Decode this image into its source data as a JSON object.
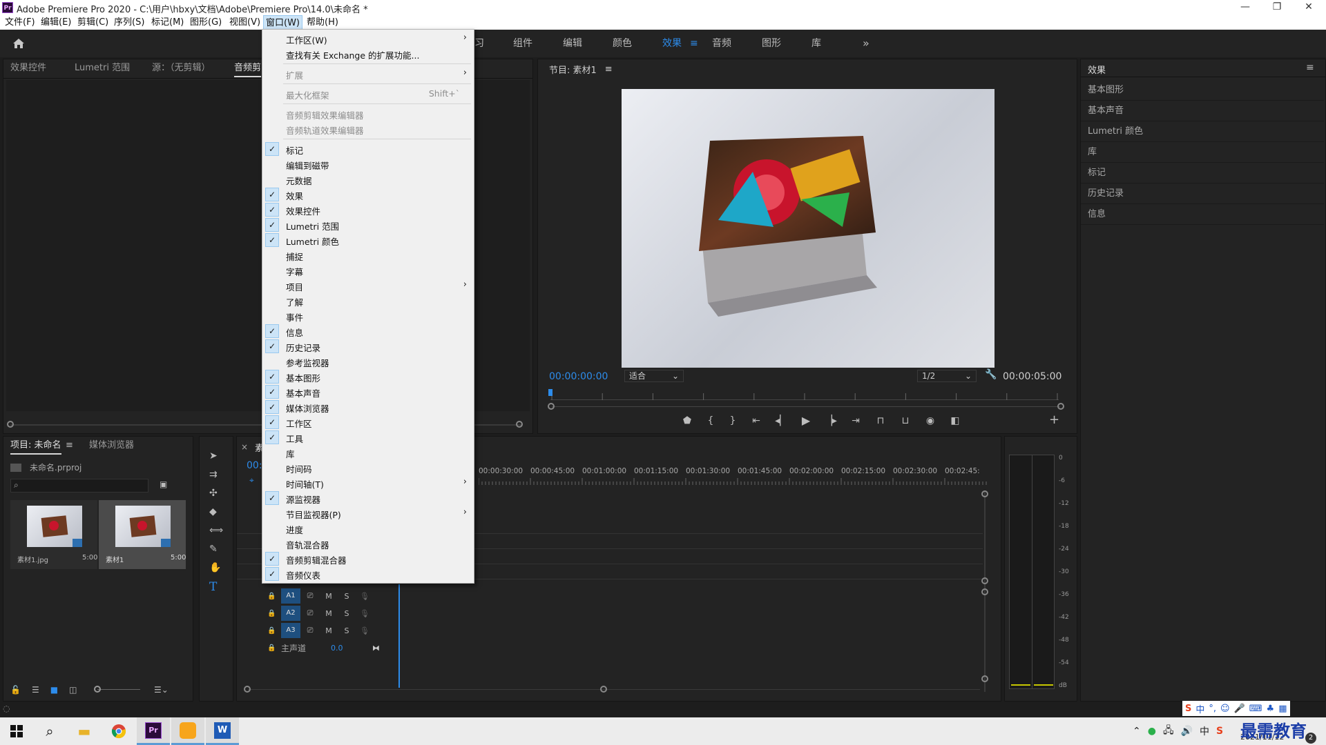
{
  "window": {
    "app_title": "Adobe Premiere Pro 2020 - C:\\用户\\hbxy\\文档\\Adobe\\Premiere Pro\\14.0\\未命名 *",
    "minimize": "—",
    "maximize": "❐",
    "close": "✕"
  },
  "menubar": {
    "items": [
      "文件(F)",
      "编辑(E)",
      "剪辑(C)",
      "序列(S)",
      "标记(M)",
      "图形(G)",
      "视图(V)",
      "窗口(W)",
      "帮助(H)"
    ],
    "active": "窗口(W)"
  },
  "workspaces": {
    "tabs": [
      "习",
      "组件",
      "编辑",
      "颜色",
      "效果",
      "音频",
      "图形",
      "库"
    ],
    "active": "效果",
    "more": "»"
  },
  "window_menu": {
    "items": [
      {
        "label": "工作区(W)",
        "checked": false,
        "submenu": true,
        "disabled": false
      },
      {
        "label": "查找有关 Exchange 的扩展功能...",
        "checked": false,
        "submenu": false,
        "disabled": false
      },
      {
        "label": "扩展",
        "checked": false,
        "submenu": true,
        "disabled": true
      },
      {
        "label": "最大化框架",
        "checked": false,
        "submenu": false,
        "disabled": true,
        "shortcut": "Shift+`"
      },
      {
        "label": "音频剪辑效果编辑器",
        "checked": false,
        "submenu": false,
        "disabled": true
      },
      {
        "label": "音频轨道效果编辑器",
        "checked": false,
        "submenu": false,
        "disabled": true
      },
      {
        "label": "标记",
        "checked": true,
        "submenu": false,
        "disabled": false
      },
      {
        "label": "编辑到磁带",
        "checked": false,
        "submenu": false,
        "disabled": false
      },
      {
        "label": "元数据",
        "checked": false,
        "submenu": false,
        "disabled": false
      },
      {
        "label": "效果",
        "checked": true,
        "submenu": false,
        "disabled": false
      },
      {
        "label": "效果控件",
        "checked": true,
        "submenu": false,
        "disabled": false
      },
      {
        "label": "Lumetri 范围",
        "checked": true,
        "submenu": false,
        "disabled": false
      },
      {
        "label": "Lumetri 颜色",
        "checked": true,
        "submenu": false,
        "disabled": false
      },
      {
        "label": "捕捉",
        "checked": false,
        "submenu": false,
        "disabled": false
      },
      {
        "label": "字幕",
        "checked": false,
        "submenu": false,
        "disabled": false
      },
      {
        "label": "项目",
        "checked": false,
        "submenu": true,
        "disabled": false
      },
      {
        "label": "了解",
        "checked": false,
        "submenu": false,
        "disabled": false
      },
      {
        "label": "事件",
        "checked": false,
        "submenu": false,
        "disabled": false
      },
      {
        "label": "信息",
        "checked": true,
        "submenu": false,
        "disabled": false
      },
      {
        "label": "历史记录",
        "checked": true,
        "submenu": false,
        "disabled": false
      },
      {
        "label": "参考监视器",
        "checked": false,
        "submenu": false,
        "disabled": false
      },
      {
        "label": "基本图形",
        "checked": true,
        "submenu": false,
        "disabled": false
      },
      {
        "label": "基本声音",
        "checked": true,
        "submenu": false,
        "disabled": false
      },
      {
        "label": "媒体浏览器",
        "checked": true,
        "submenu": false,
        "disabled": false
      },
      {
        "label": "工作区",
        "checked": true,
        "submenu": false,
        "disabled": false
      },
      {
        "label": "工具",
        "checked": true,
        "submenu": false,
        "disabled": false
      },
      {
        "label": "库",
        "checked": false,
        "submenu": false,
        "disabled": false
      },
      {
        "label": "时间码",
        "checked": false,
        "submenu": false,
        "disabled": false
      },
      {
        "label": "时间轴(T)",
        "checked": false,
        "submenu": true,
        "disabled": false
      },
      {
        "label": "源监视器",
        "checked": true,
        "submenu": false,
        "disabled": false
      },
      {
        "label": "节目监视器(P)",
        "checked": false,
        "submenu": true,
        "disabled": false
      },
      {
        "label": "进度",
        "checked": false,
        "submenu": false,
        "disabled": false
      },
      {
        "label": "音轨混合器",
        "checked": false,
        "submenu": false,
        "disabled": false
      },
      {
        "label": "音频剪辑混合器",
        "checked": true,
        "submenu": false,
        "disabled": false
      },
      {
        "label": "音频仪表",
        "checked": true,
        "submenu": false,
        "disabled": false
      }
    ],
    "check_glyph": "✓",
    "arrow_glyph": "›"
  },
  "source_panel": {
    "tabs": [
      "效果控件",
      "Lumetri 范围",
      "源：（无剪辑）",
      "音频剪"
    ],
    "active": "音频剪"
  },
  "program_monitor": {
    "title": "节目: 素材1",
    "menu_icon": "≡",
    "timecode_current": "00:00:00:00",
    "fit_label": "适合",
    "resolution": "1/2",
    "timecode_duration": "00:00:05:00"
  },
  "effects_panel": {
    "title": "效果",
    "menu_icon": "≡",
    "items": [
      "基本图形",
      "基本声音",
      "Lumetri 颜色",
      "库",
      "标记",
      "历史记录",
      "信息"
    ]
  },
  "project_panel": {
    "tabs": [
      "项目: 未命名",
      "媒体浏览器"
    ],
    "menu_icon": "≡",
    "project_file": "未命名.prproj",
    "items": [
      {
        "name": "素材1.jpg",
        "duration": "5:00"
      },
      {
        "name": "素材1",
        "duration": "5:00"
      }
    ]
  },
  "timeline": {
    "tab_close": "×",
    "tab_label": "素",
    "timecode": "00:",
    "ruler": [
      "00:00:30:00",
      "00:00:45:00",
      "00:01:00:00",
      "00:01:15:00",
      "00:01:30:00",
      "00:01:45:00",
      "00:02:00:00",
      "00:02:15:00",
      "00:02:30:00",
      "00:02:45:"
    ],
    "audio_tracks": [
      "A1",
      "A2",
      "A3"
    ],
    "mute": "M",
    "solo": "S",
    "master_label": "主声道",
    "master_value": "0.0"
  },
  "audio_meter": {
    "scale": [
      "0",
      "-6",
      "-12",
      "-18",
      "-24",
      "-30",
      "-36",
      "-42",
      "-48",
      "-54",
      "dB"
    ]
  },
  "taskbar": {
    "date": "2021/11/12",
    "ime_text": "中",
    "watermark": "最需教育",
    "watermark_badge": "2"
  },
  "colors": {
    "accent_blue": "#2d8ceb",
    "panel_bg": "#232323",
    "menu_bg": "#f0f0f0"
  }
}
